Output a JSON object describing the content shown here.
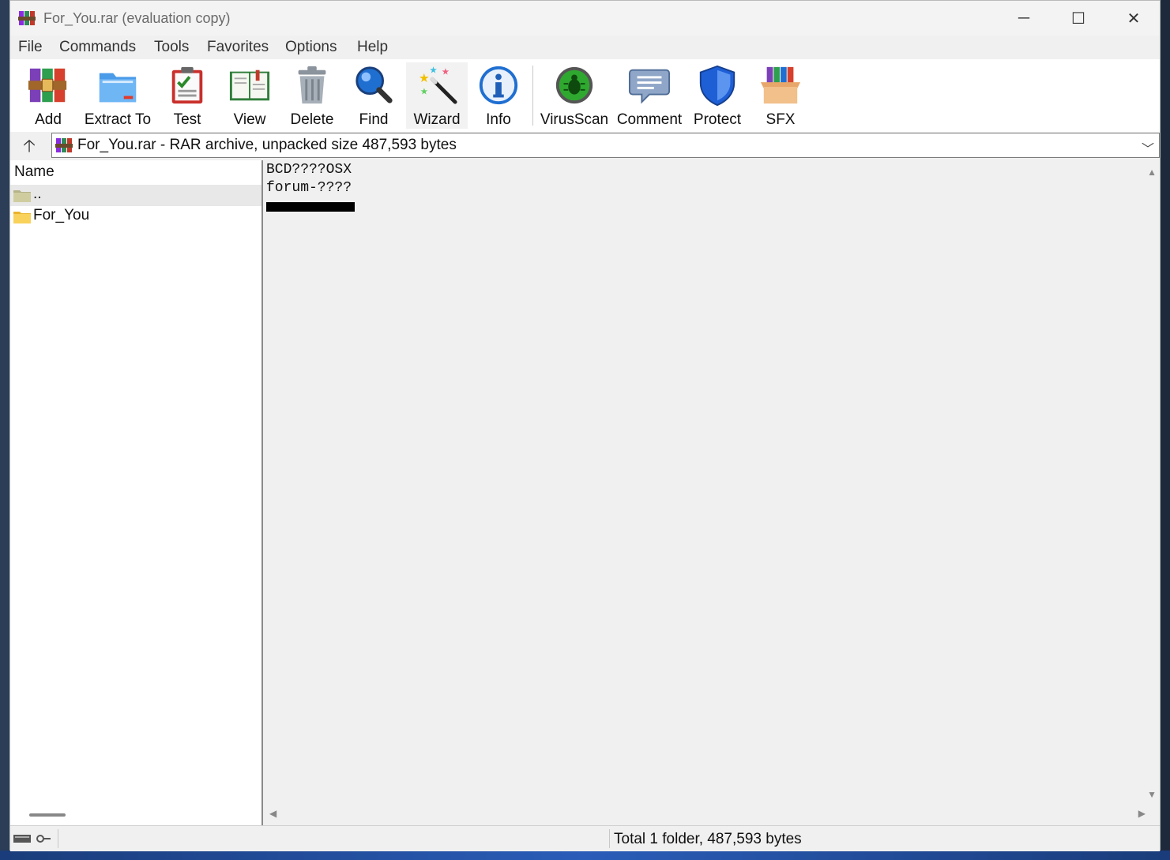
{
  "window": {
    "title": "For_You.rar (evaluation copy)",
    "minimize_glyph": "─",
    "maximize_glyph": "☐",
    "close_glyph": "✕"
  },
  "menu": [
    "File",
    "Commands",
    "Tools",
    "Favorites",
    "Options",
    "Help"
  ],
  "toolbar": [
    {
      "label": "Add",
      "icon": "add-archive-icon"
    },
    {
      "label": "Extract To",
      "icon": "extract-folder-icon"
    },
    {
      "label": "Test",
      "icon": "test-clipboard-icon"
    },
    {
      "label": "View",
      "icon": "view-book-icon"
    },
    {
      "label": "Delete",
      "icon": "trash-can-icon"
    },
    {
      "label": "Find",
      "icon": "magnifier-icon"
    },
    {
      "label": "Wizard",
      "icon": "magic-wand-icon"
    },
    {
      "label": "Info",
      "icon": "info-icon"
    },
    {
      "label": "VirusScan",
      "icon": "virus-scan-icon"
    },
    {
      "label": "Comment",
      "icon": "comment-bubble-icon"
    },
    {
      "label": "Protect",
      "icon": "shield-icon"
    },
    {
      "label": "SFX",
      "icon": "sfx-box-icon"
    }
  ],
  "address": {
    "up_glyph": "🡡",
    "text": "For_You.rar - RAR archive, unpacked size 487,593 bytes",
    "dropdown_glyph": "﹀"
  },
  "file_list": {
    "column_name": "Name",
    "rows": [
      {
        "name": ".."
      },
      {
        "name": "For_You"
      }
    ]
  },
  "comment": {
    "line1": "BCD????OSX",
    "line2": "forum-????"
  },
  "scroll": {
    "up": "▲",
    "down": "▼",
    "left": "◀",
    "right": "▶"
  },
  "status": {
    "text": "Total 1 folder, 487,593 bytes"
  },
  "colors": {
    "window_bg": "#f0f0f0",
    "toolbar_bg": "#ffffff",
    "accent_blue": "#1f6fd1",
    "virus_green": "#2fa82f",
    "delete_gray": "#8b939c"
  }
}
